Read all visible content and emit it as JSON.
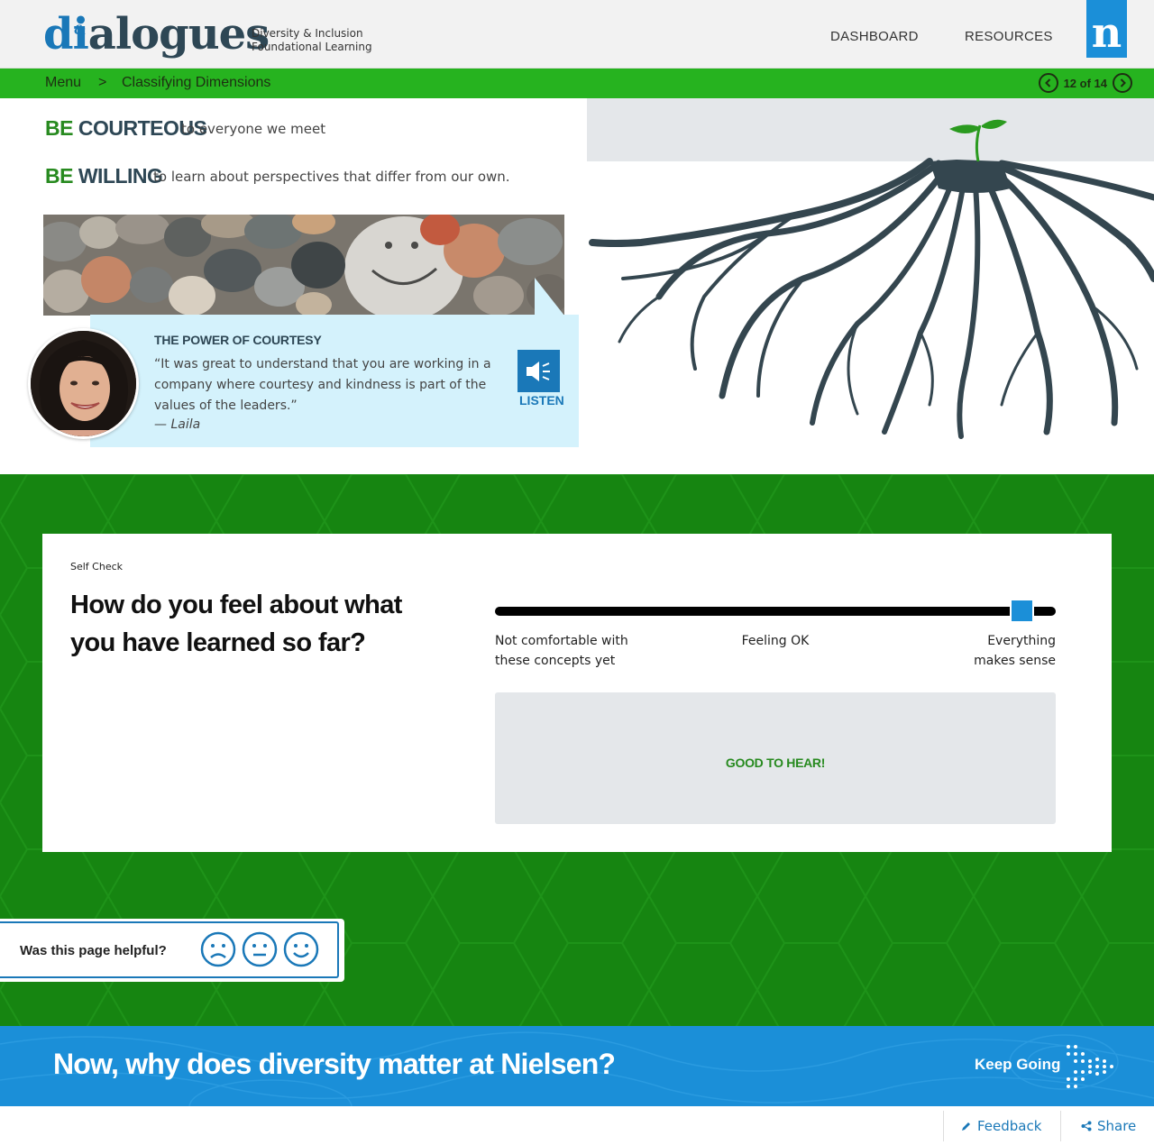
{
  "header": {
    "logo_text_di": "di",
    "logo_text_rest": "alogues",
    "logo_amp": "&",
    "subtitle_line1": "Diversity & Inclusion",
    "subtitle_line2": "Foundational Learning",
    "nav": [
      "DASHBOARD",
      "RESOURCES"
    ],
    "brand_icon": "n"
  },
  "breadcrumb": {
    "menu": "Menu",
    "separator": ">",
    "current": "Classifying Dimensions",
    "pager_text": "12 of 14"
  },
  "intro": {
    "items": [
      {
        "be": "BE",
        "word": "COURTEOUS",
        "desc": "to everyone we meet"
      },
      {
        "be": "BE",
        "word": "WILLING",
        "desc": "to learn about perspectives that differ from our own."
      }
    ]
  },
  "quote": {
    "title": "THE POWER OF COURTESY",
    "text": "“It was great to understand that you are working in a company where courtesy and kindness is part of the values of the leaders.”",
    "author": "— Laila",
    "listen_label": "LISTEN"
  },
  "self_check": {
    "label": "Self Check",
    "question": "How do you feel about what you have learned so far?",
    "scale_left": "Not comfortable with these concepts yet",
    "scale_mid": "Feeling OK",
    "scale_right": "Everything makes sense",
    "slider_value_percent": 96,
    "feedback": "GOOD TO HEAR!"
  },
  "helpful": {
    "question": "Was this page helpful?",
    "faces": [
      "sad-face-icon",
      "neutral-face-icon",
      "happy-face-icon"
    ]
  },
  "next": {
    "title": "Now, why does diversity matter at Nielsen?",
    "keep_going": "Keep Going"
  },
  "footer": {
    "feedback": "Feedback",
    "share": "Share"
  },
  "colors": {
    "brand_blue": "#1b8fd8",
    "dark_blue": "#1a78b8",
    "bright_green": "#26b31f",
    "deep_green": "#168511",
    "text_green": "#278a1f",
    "slate": "#2e4755",
    "quote_bg": "#d4f2fc"
  }
}
